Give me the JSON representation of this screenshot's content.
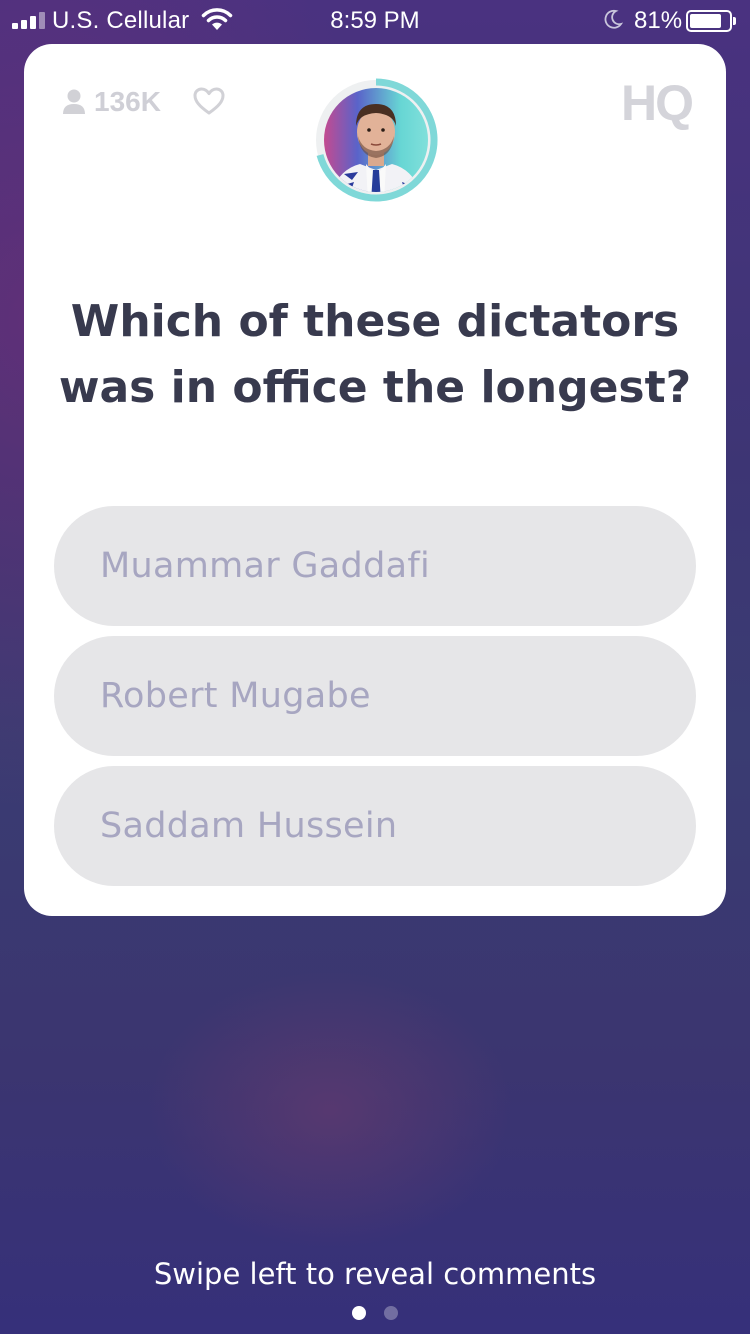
{
  "status_bar": {
    "carrier": "U.S. Cellular",
    "time": "8:59 PM",
    "battery_percent": "81%",
    "battery_level": 0.81,
    "signal_bars": 3
  },
  "header": {
    "viewer_count": "136K",
    "logo": "HQ"
  },
  "question": {
    "text": "Which of these dictators was in office the longest?"
  },
  "answers": [
    {
      "label": "Muammar Gaddafi"
    },
    {
      "label": "Robert Mugabe"
    },
    {
      "label": "Saddam Hussein"
    }
  ],
  "footer": {
    "hint": "Swipe left to reveal comments",
    "pages": 2,
    "active_page": 1
  },
  "colors": {
    "accent_timer": "#7fd8d8",
    "ring_pink": "#e14b88",
    "question_text": "#383a4e",
    "answer_bg": "#e6e6e8",
    "answer_text": "#a7a6c1"
  }
}
